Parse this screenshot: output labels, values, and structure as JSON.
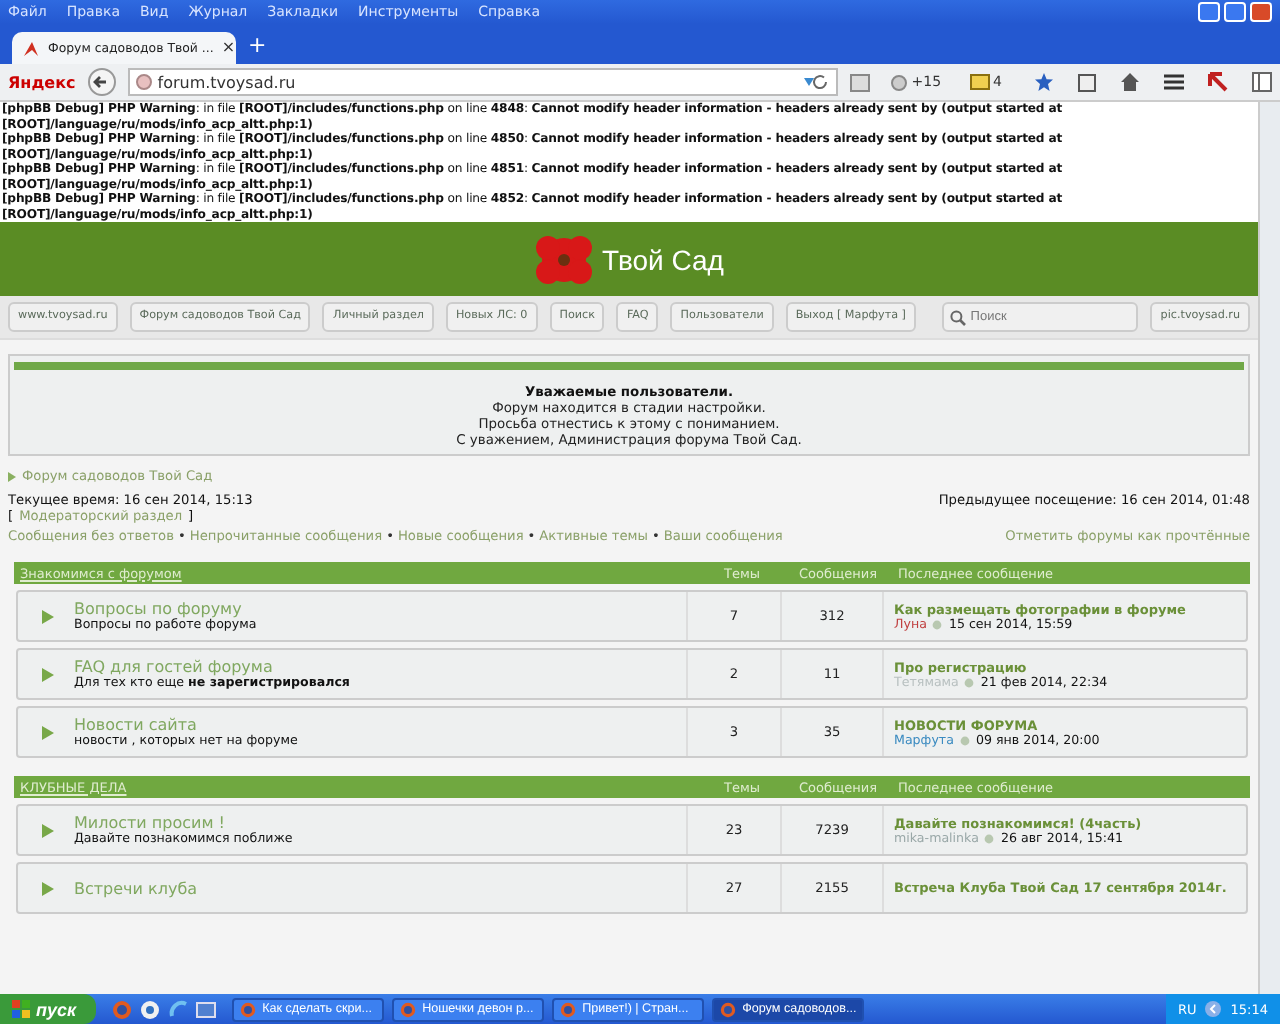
{
  "menu": [
    "Файл",
    "Правка",
    "Вид",
    "Журнал",
    "Закладки",
    "Инструменты",
    "Справка"
  ],
  "tabs": [
    {
      "label": "Форум садоводов Твой ...",
      "selected": true,
      "close": "×"
    }
  ],
  "new_tab": "+",
  "toolbar": {
    "search_brand": "Яндекс",
    "url": "forum.tvoysad.ru",
    "badges": [
      "+15",
      "4"
    ]
  },
  "debug": [
    "**[phpBB Debug] PHP Warning**: in file **[ROOT]/includes/functions.php** on line **4848**: **Cannot modify header information - headers already sent by (output started at [ROOT]/language/ru/mods/info_acp_altt.php:1)**",
    "**[phpBB Debug] PHP Warning**: in file **[ROOT]/includes/functions.php** on line **4850**: **Cannot modify header information - headers already sent by (output started at [ROOT]/language/ru/mods/info_acp_altt.php:1)**",
    "**[phpBB Debug] PHP Warning**: in file **[ROOT]/includes/functions.php** on line **4851**: **Cannot modify header information - headers already sent by (output started at [ROOT]/language/ru/mods/info_acp_altt.php:1)**",
    "**[phpBB Debug] PHP Warning**: in file **[ROOT]/includes/functions.php** on line **4852**: **Cannot modify header information - headers already sent by (output started at [ROOT]/language/ru/mods/info_acp_altt.php:1)**"
  ],
  "site_title": "Твой Сад",
  "nav": [
    "www.tvoysad.ru",
    "Форум садоводов Твой Сад",
    "Личный раздел",
    "Новых ЛС: 0",
    "Поиск",
    "FAQ",
    "Пользователи",
    "Выход [ Марфута ]",
    "pic.tvoysad.ru"
  ],
  "search": {
    "placeholder": "Поиск"
  },
  "notice": {
    "title": "Уважаемые пользователи.",
    "lines": [
      "Форум находится в стадии настройки.",
      "Просьба отнестись к этому с пониманием.",
      "С уважением, Администрация форума Твой Сад."
    ]
  },
  "breadcrumb": "Форум садоводов Твой Сад",
  "current_time": "Текущее время: 16 сен 2014, 15:13",
  "previous_visit": "Предыдущее посещение: 16 сен 2014, 01:48",
  "moderator": {
    "open": "[",
    "link": "Модераторский раздел",
    "close": "]"
  },
  "quick_links": [
    "Сообщения без ответов",
    "Непрочитанные сообщения",
    "Новые сообщения",
    "Активные темы",
    "Ваши сообщения"
  ],
  "quick_link_separators": [
    "•",
    "•",
    "•",
    "•"
  ],
  "mark_read": "Отметить форумы как прочтённые",
  "sections": [
    {
      "title": "Знакомимся с форумом",
      "columns": [
        "Темы",
        "Сообщения",
        "Последнее сообщение"
      ],
      "forums": [
        {
          "title": "Вопросы по форуму",
          "desc": "Вопросы по работе форума",
          "topics": "7",
          "posts": "312",
          "last_title": "Как размещать фотографии в форуме",
          "author": "Луна",
          "color": "#c04040",
          "time": "15 сен 2014, 15:59"
        },
        {
          "title": "FAQ для гостей форума",
          "desc": "Для тех кто еще **не зарегистрировался**",
          "topics": "2",
          "posts": "11",
          "last_title": "Про регистрацию",
          "author": "Тетямама",
          "color": "#b8c0c0",
          "time": "21 фев 2014, 22:34"
        },
        {
          "title": "Новости сайта",
          "desc": "новости , которых нет на форуме",
          "topics": "3",
          "posts": "35",
          "last_title": "НОВОСТИ ФОРУМА",
          "author": "Марфута",
          "color": "#3a8ac0",
          "time": "09 янв 2014, 20:00"
        }
      ]
    },
    {
      "title": "КЛУБНЫЕ ДЕЛА",
      "columns": [
        "Темы",
        "Сообщения",
        "Последнее сообщение"
      ],
      "forums": [
        {
          "title": "Милости просим !",
          "desc": "Давайте познакомимся поближе",
          "topics": "23",
          "posts": "7239",
          "last_title": "Давайте познакомимся! (4часть)",
          "author": "mika-malinka",
          "color": "#9aa8a8",
          "time": "26 авг 2014, 15:41"
        },
        {
          "title": "Встречи клуба",
          "topics": "27",
          "posts": "2155",
          "last_title": "Встреча Клуба Твой Сад 17 сентября 2014г."
        }
      ]
    }
  ],
  "taskbar": {
    "start": "пуск",
    "tasks": [
      {
        "label": "Как сделать скри...",
        "selected": false
      },
      {
        "label": "Ношечки девон р...",
        "selected": false
      },
      {
        "label": "Привет!) | Стран...",
        "selected": false
      },
      {
        "label": "Форум садоводов...",
        "selected": true
      }
    ],
    "lang": "RU",
    "clock": "15:14"
  }
}
